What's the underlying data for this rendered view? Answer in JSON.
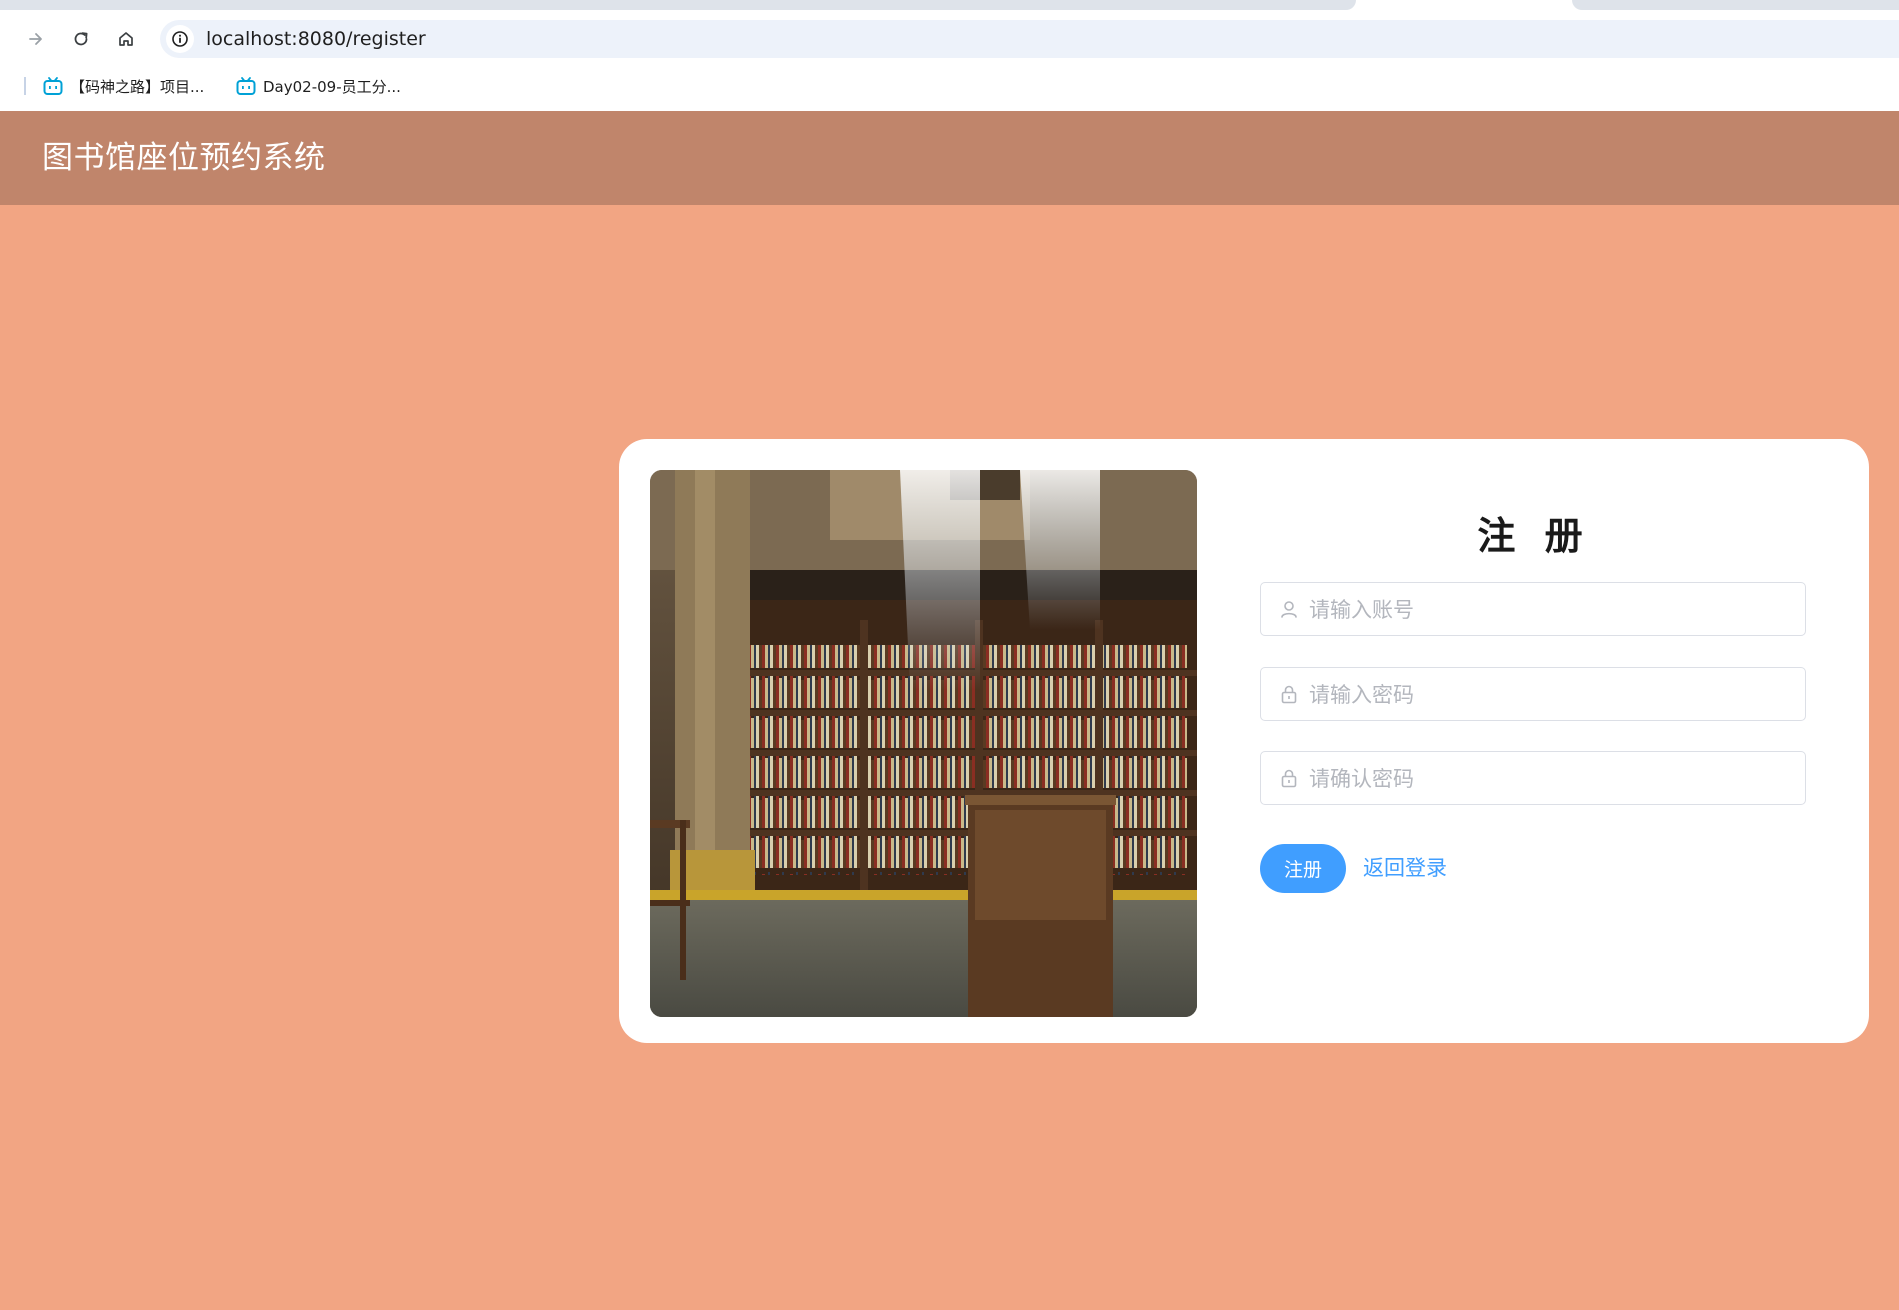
{
  "browser": {
    "url": "localhost:8080/register",
    "bookmarks": [
      {
        "label": "【码神之路】项目...",
        "icon": "bilibili-icon"
      },
      {
        "label": "Day02-09-员工分...",
        "icon": "bilibili-icon"
      }
    ],
    "icons": {
      "forward": "arrow-right-icon",
      "reload": "reload-icon",
      "home": "home-icon",
      "site_info": "info-icon"
    }
  },
  "app": {
    "title": "图书馆座位预约系统"
  },
  "register": {
    "heading": "注 册",
    "fields": {
      "username": {
        "placeholder": "请输入账号",
        "icon": "user-icon"
      },
      "password": {
        "placeholder": "请输入密码",
        "icon": "lock-icon"
      },
      "confirm": {
        "placeholder": "请确认密码",
        "icon": "lock-icon"
      }
    },
    "submit_label": "注册",
    "back_label": "返回登录"
  },
  "colors": {
    "page_background": "#f2a583",
    "header_background": "#c0856b",
    "primary": "#409eff",
    "bookmark_icon": "#00a1d6"
  }
}
